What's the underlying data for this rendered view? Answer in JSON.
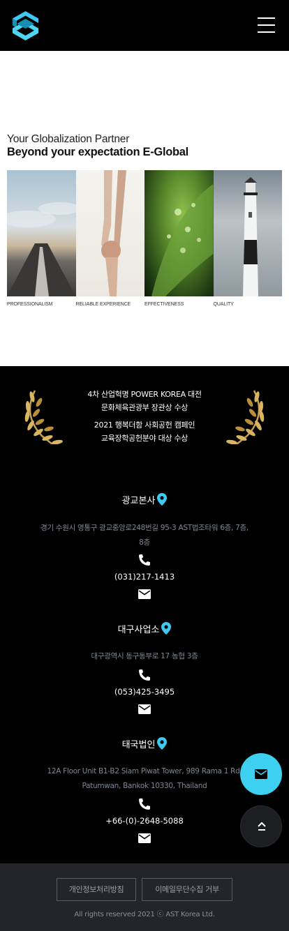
{
  "header": {
    "logo_name": "ast-logo",
    "menu_icon": "hamburger-menu-icon"
  },
  "hero": {
    "tagline": "Your Globalization Partner",
    "headline": "Beyond your expectation E-Global",
    "panels": [
      {
        "label": "PROFESSIONALISM"
      },
      {
        "label": "RELIABLE EXPERIENCE"
      },
      {
        "label": "EFFECTIVENESS"
      },
      {
        "label": "QUALITY"
      }
    ]
  },
  "awards": {
    "lines": [
      "4차 산업혁명 POWER KOREA 대전",
      "문화체육관광부 장관상 수상",
      "2021 행복더함 사회공헌 캠페인",
      "교육장학공헌분야 대상 수상"
    ]
  },
  "offices": [
    {
      "title": "광교본사",
      "address_line1": "경기 수원시 영통구 광교중앙로248번길 95-3 AST법조타워 6층, 7층,",
      "address_line2": "8층",
      "phone": "(031)217-1413"
    },
    {
      "title": "대구사업소",
      "address_line1": "대구광역시 동구동부로 17 농협 3층",
      "phone": "(053)425-3495"
    },
    {
      "title": "태국법인",
      "address_line1": "12A Floor Unit B1-B2 Siam Piwat Tower, 989 Rama 1 Rd,",
      "address_line2": "Patumwan, Bankok 10330, Thailand",
      "phone": "+66-(0)-2648-5088"
    }
  ],
  "colors": {
    "accent": "#3ed0f1",
    "pin": "#3ec9f0",
    "footer_bg": "#23252b"
  },
  "footer": {
    "privacy_label": "개인정보처리방침",
    "email_refusal_label": "이메일무단수집 거부",
    "copyright": "All rights reserved 2021 ⓒ AST Korea Ltd."
  }
}
